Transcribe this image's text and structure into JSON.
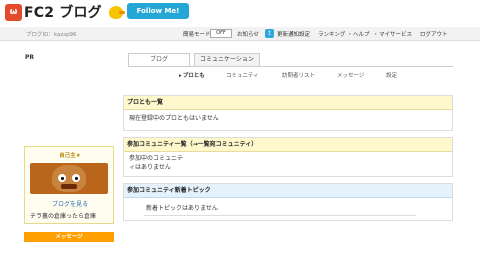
{
  "header": {
    "logo_mark": "ω",
    "logo_text": "FC2 ブログ",
    "follow_label": "Follow Me!"
  },
  "subbar": {
    "blog_id": "ブログID：kazsp96",
    "easy_mode_label": "簡易モード：",
    "easy_mode_value": "OFF",
    "links": {
      "notice": "お知らせ",
      "twitter_icon": "t",
      "update_notice": "更新通知設定",
      "ranking": "ランキング",
      "help": "ヘルプ",
      "my_service": "マイサービス",
      "logout": "ログアウト"
    },
    "separator": "・"
  },
  "sidebar": {
    "pr": "PR",
    "profile": {
      "title": "自己主★",
      "view_blog": "ブログを見る",
      "description": "チラ裏の倉庫ったら倉庫"
    },
    "message_button": "メッセージ"
  },
  "tabs": [
    {
      "label": "ブログ",
      "active": false
    },
    {
      "label": "コミュニケーション",
      "active": true
    }
  ],
  "subnav": [
    {
      "label": "プロとも",
      "active": true
    },
    {
      "label": "コミュニティ",
      "active": false
    },
    {
      "label": "訪問者リスト",
      "active": false
    },
    {
      "label": "メッセージ",
      "active": false
    },
    {
      "label": "設定",
      "active": false
    }
  ],
  "panels": {
    "protomo": {
      "title": "プロとも一覧",
      "body": "現在登録中のプロともはいません"
    },
    "community": {
      "title": "参加コミュニティ一覧（→一覧宛コミュニティ）",
      "body_line1": "参加中のコミュニテ",
      "body_line2": "ィはありません"
    },
    "topics": {
      "title": "参加コミュニティ新着トピック",
      "body": "新着トピックはありません"
    }
  },
  "colors": {
    "accent_orange": "#ffa000",
    "follow_blue": "#24a7d6",
    "logo_red": "#e44b2a",
    "panel_yellow": "#fff8cc",
    "panel_blue": "#e6f2fb"
  }
}
